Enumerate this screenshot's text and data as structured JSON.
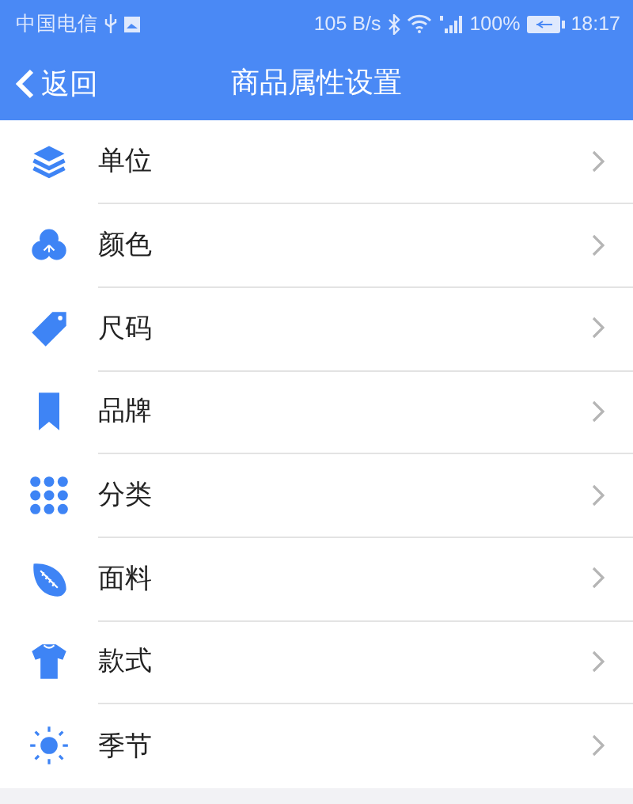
{
  "status_bar": {
    "carrier": "中国电信",
    "speed": "105 B/s",
    "battery": "100%",
    "time": "18:17"
  },
  "nav_bar": {
    "back": "返回",
    "title": "商品属性设置"
  },
  "items": [
    {
      "kind": "layers",
      "label": "单位"
    },
    {
      "kind": "circles",
      "label": "颜色"
    },
    {
      "kind": "tag",
      "label": "尺码"
    },
    {
      "kind": "bookmark",
      "label": "品牌"
    },
    {
      "kind": "grid",
      "label": "分类"
    },
    {
      "kind": "ball",
      "label": "面料"
    },
    {
      "kind": "shirt",
      "label": "款式"
    },
    {
      "kind": "sun",
      "label": "季节"
    }
  ]
}
